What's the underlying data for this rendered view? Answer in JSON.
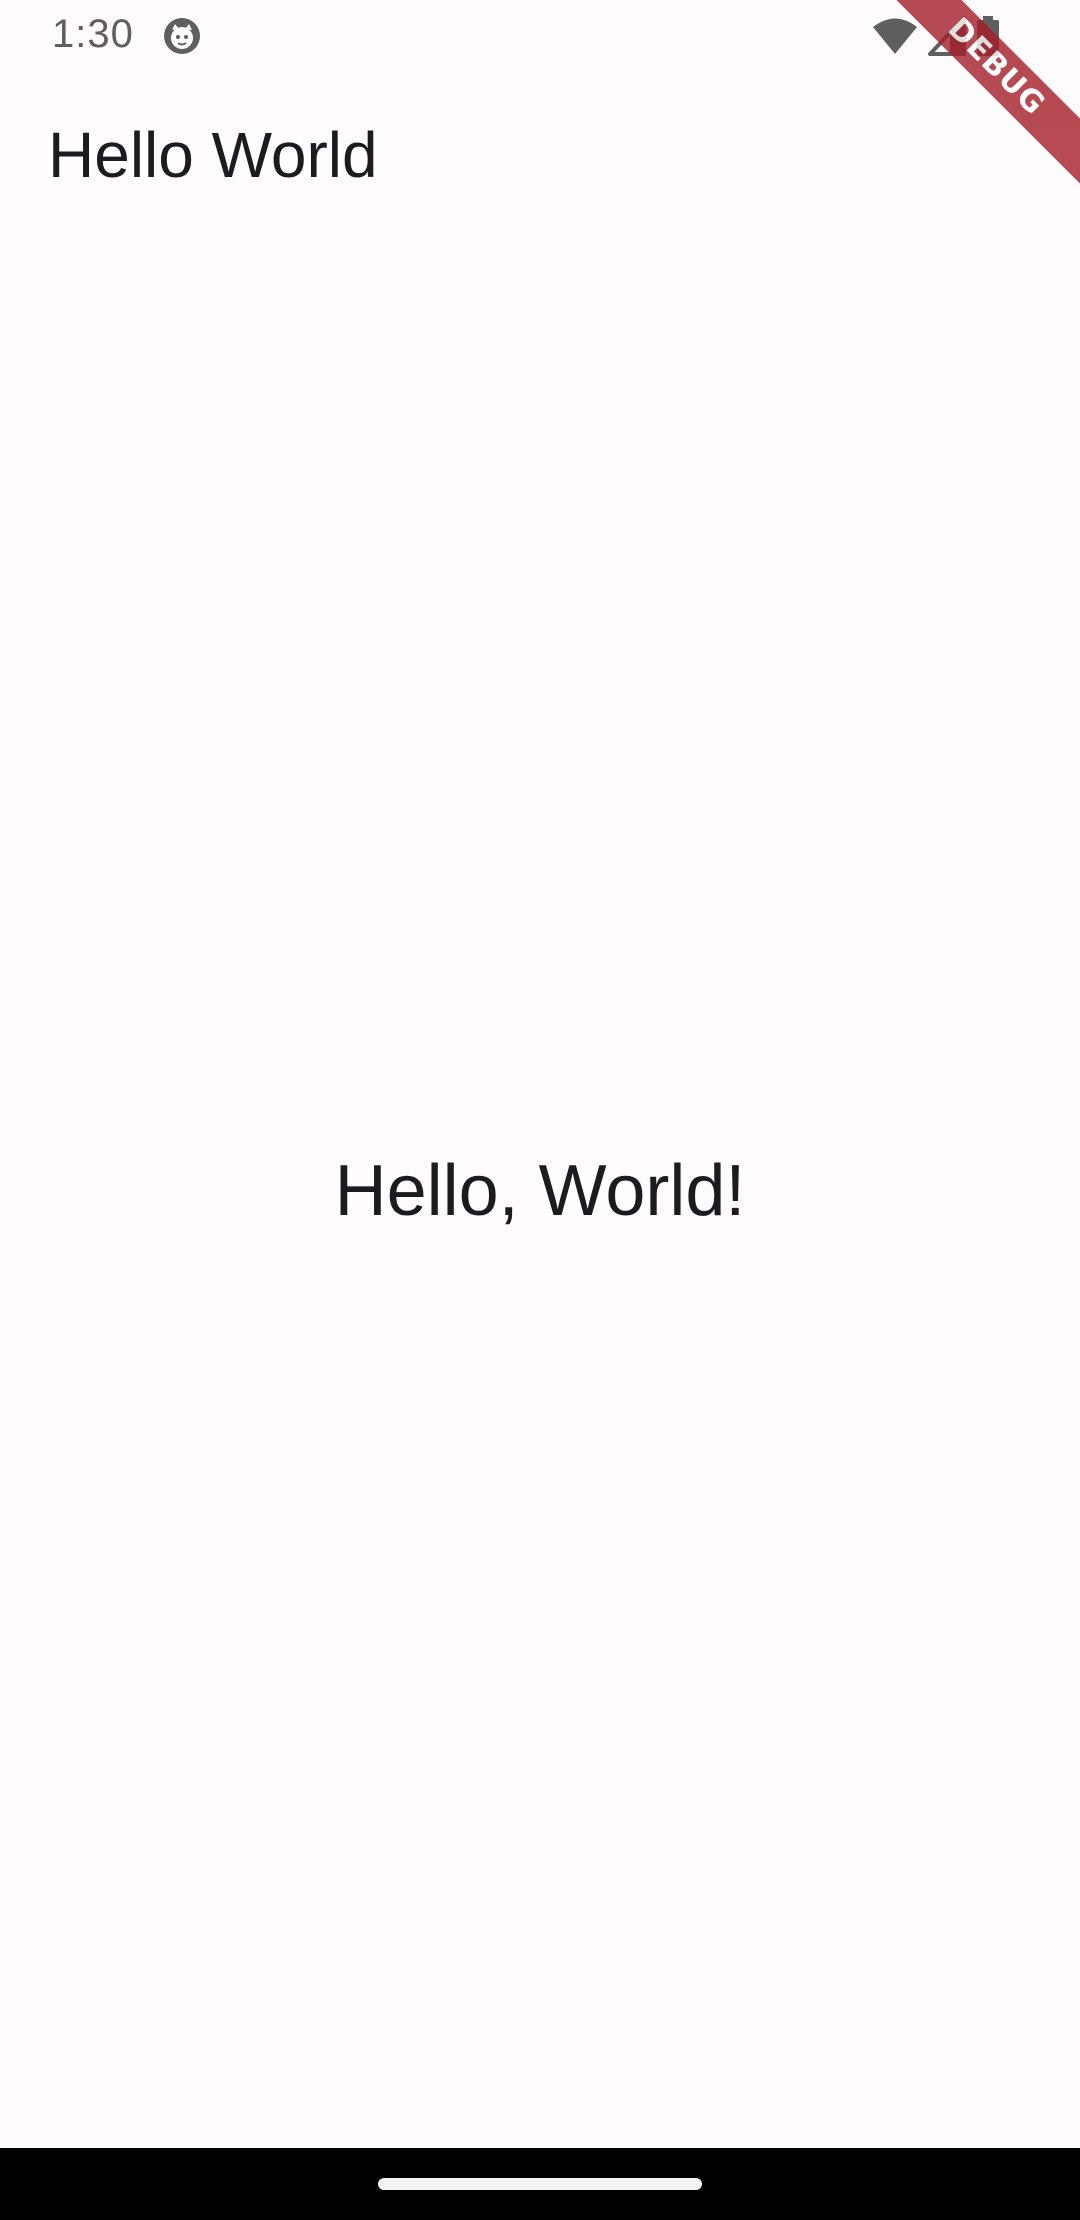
{
  "status_bar": {
    "time": "1:30",
    "notification_icon": "face-icon",
    "icons": [
      "wifi-icon",
      "signal-icon",
      "battery-icon"
    ]
  },
  "app_bar": {
    "title": "Hello World"
  },
  "body": {
    "center_text": "Hello, World!"
  },
  "debug_banner": {
    "label": "DEBUG"
  },
  "colors": {
    "background": "#fffbfe",
    "text": "#1c1b1f",
    "status_text": "#5f5f5f",
    "debug_banner": "#a51e28",
    "nav_bar": "#000000"
  }
}
